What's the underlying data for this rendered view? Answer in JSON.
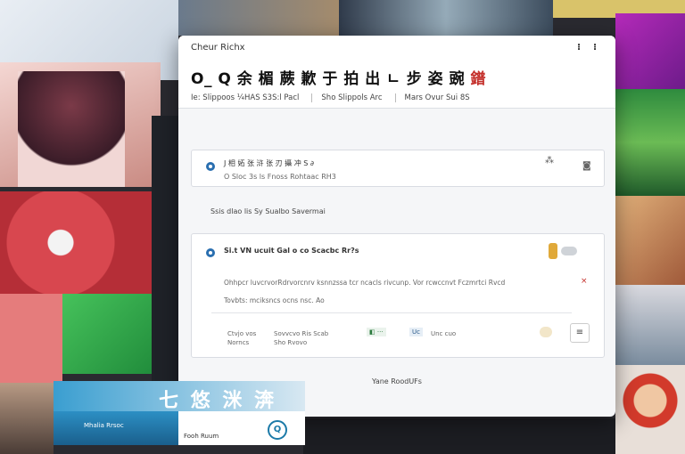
{
  "window": {
    "title": "Cheur Richx",
    "menu_glyph": "⁝",
    "close_glyph": "⁝"
  },
  "header": {
    "title": "O_ Q 余 楣 蕨 歉 于 拍 出 ㄴ 步 姿 豌 ",
    "title_accent": "鐠",
    "sub1": "Ie: Slippoos ¼HAS S3S:l  Pacl",
    "sub2": "Sho Slippols Arc",
    "sub3": "Mars Ovur Sui 8S"
  },
  "card1": {
    "title": "J 相 妬 张 浒 张 刃 攝 冲 S ∂",
    "desc": "O Sloc 3s ls Fnoss Rohtaac RH3",
    "icon1": "⁂",
    "icon2": "◙"
  },
  "section_label": "Ssis dlao lis Sy Sualbo Savermai",
  "card2": {
    "title": "Si.t VN ucuit Gal o co   Scacbc Rr?s",
    "desc": "Ohhpcr luvcrvorRdrvorcnrv ksnnzssa tcr ncacls rivcunp. Vor rcwccnvt Fczmrtci Rvcd",
    "desc2": "Tovbts: mciksncs ocns nsc. Ao",
    "row1_left": "Ctvjo vos",
    "row1_left2": "Norncs",
    "row1_mid": "Sovvcvo  Ris Scab",
    "row1_mid2": "Sho Rvovo",
    "row1_tag1": "◧ ···",
    "row1_tag2": "Uc",
    "row1_right": "Unc cuo",
    "row1_btn": "≡"
  },
  "footer": {
    "link": "Yane RoodUFs"
  },
  "overlay": {
    "big": "七 悠 洣 渀",
    "caption": "Mhalia Rrsoc",
    "caption2": "Fooh Ruum",
    "search_glyph": "Q"
  }
}
